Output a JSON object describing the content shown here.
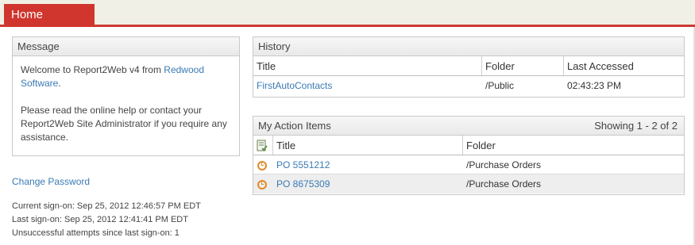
{
  "tabs": {
    "home": "Home"
  },
  "message": {
    "title": "Message",
    "line1_prefix": "Welcome to Report2Web v4 from ",
    "line1_link": "Redwood Software",
    "line1_suffix": ".",
    "line2": "Please read the online help or contact your Report2Web Site Administrator if you require any assistance."
  },
  "change_password": "Change Password",
  "signon": {
    "current": "Current sign-on: Sep 25, 2012 12:46:57 PM EDT",
    "last": "Last sign-on: Sep 25, 2012 12:41:41 PM EDT",
    "unsuccessful": "Unsuccessful attempts since last sign-on: 1"
  },
  "history": {
    "title": "History",
    "columns": [
      "Title",
      "Folder",
      "Last Accessed"
    ],
    "rows": [
      {
        "title": "FirstAutoContacts",
        "folder": "/Public",
        "accessed": "02:43:23 PM"
      }
    ]
  },
  "actions": {
    "title": "My Action Items",
    "showing": "Showing 1 - 2 of 2",
    "columns": [
      "Title",
      "Folder"
    ],
    "rows": [
      {
        "title": "PO 5551212",
        "folder": "/Purchase Orders"
      },
      {
        "title": "PO 8675309",
        "folder": "/Purchase Orders"
      }
    ]
  },
  "colors": {
    "accent": "#d0362e",
    "link": "#3a7ab5",
    "clock": "#e28a2b"
  }
}
